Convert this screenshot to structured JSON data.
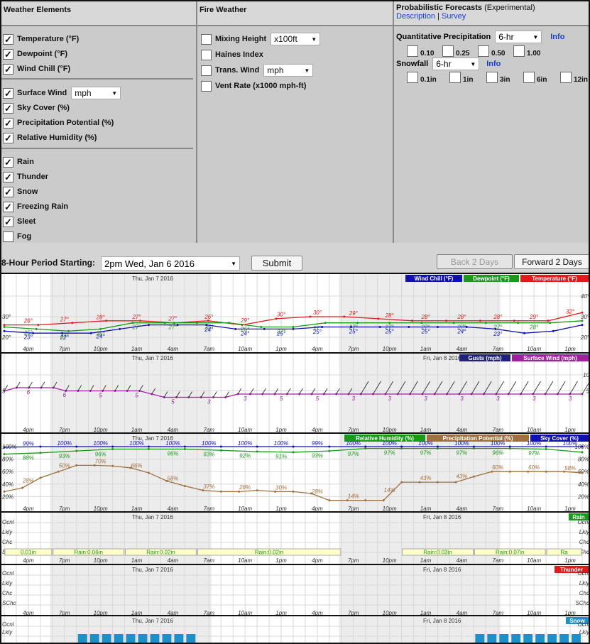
{
  "weather_elements": {
    "title": "Weather Elements",
    "group1": [
      {
        "label": "Temperature (°F)",
        "checked": true
      },
      {
        "label": "Dewpoint (°F)",
        "checked": true
      },
      {
        "label": "Wind Chill (°F)",
        "checked": true
      }
    ],
    "group2": [
      {
        "label": "Surface Wind",
        "checked": true,
        "select": "mph"
      },
      {
        "label": "Sky Cover (%)",
        "checked": true
      },
      {
        "label": "Precipitation Potential (%)",
        "checked": true
      },
      {
        "label": "Relative Humidity (%)",
        "checked": true
      }
    ],
    "group3": [
      {
        "label": "Rain",
        "checked": true
      },
      {
        "label": "Thunder",
        "checked": true
      },
      {
        "label": "Snow",
        "checked": true
      },
      {
        "label": "Freezing Rain",
        "checked": true
      },
      {
        "label": "Sleet",
        "checked": true
      },
      {
        "label": "Fog",
        "checked": false
      }
    ]
  },
  "fire_weather": {
    "title": "Fire Weather",
    "items": [
      {
        "label": "Mixing Height",
        "checked": false,
        "select": "x100ft"
      },
      {
        "label": "Haines Index",
        "checked": false
      },
      {
        "label": "Trans. Wind",
        "checked": false,
        "select": "mph"
      },
      {
        "label": "Vent Rate (x1000 mph-ft)",
        "checked": false
      }
    ]
  },
  "probabilistic": {
    "title": "Probabilistic Forecasts",
    "title_note": "(Experimental)",
    "link_description": "Description",
    "link_sep": "|",
    "link_survey": "Survey",
    "qpf_label": "Quantitative Precipitation",
    "qpf_select": "6-hr",
    "qpf_info": "Info",
    "qpf_options": [
      "0.10",
      "0.25",
      "0.50",
      "1.00"
    ],
    "snow_label": "Snowfall",
    "snow_select": "6-hr",
    "snow_info": "Info",
    "snow_options": [
      "0.1in",
      "1in",
      "3in",
      "6in",
      "12in"
    ]
  },
  "controls": {
    "period_label": "8-Hour Period Starting:",
    "period_value": "2pm Wed, Jan 6 2016",
    "submit": "Submit",
    "back": "Back 2 Days",
    "forward": "Forward 2 Days"
  },
  "time_labels": [
    "4pm",
    "7pm",
    "10pm",
    "1am",
    "4am",
    "7am",
    "10am",
    "1pm",
    "4pm",
    "7pm",
    "10pm",
    "1am",
    "4am",
    "7am",
    "10am",
    "1pm"
  ],
  "date_labels": {
    "thu": "Thu, Jan 7 2016",
    "fri": "Fri, Jan 8 2016"
  },
  "colors": {
    "temp": "#e31a1c",
    "dew": "#1a9a1a",
    "chill": "#1010b0",
    "gust": "#202080",
    "wind": "#a020a0",
    "rh": "#1a9a1a",
    "pop": "#a07040",
    "sky": "#1010b0",
    "rain": "#1a9a1a",
    "thunder": "#e31a1c",
    "snow": "#1e90c8"
  },
  "chart_data": [
    {
      "type": "line",
      "legend": [
        "Wind Chill (°F)",
        "Dewpoint (°F)",
        "Temperature (°F)"
      ],
      "y_ticks_right": [
        "40°",
        "30°",
        "20°"
      ],
      "y_ticks_left": [
        "30°",
        "20°"
      ],
      "x_hours": [
        0,
        3,
        6,
        9,
        12,
        15,
        18,
        21,
        24,
        27,
        30,
        33,
        36,
        39,
        42,
        45,
        48
      ],
      "series": [
        {
          "name": "Temperature (°F)",
          "values": [
            26,
            26,
            27,
            28,
            28,
            27,
            28,
            26,
            29,
            30,
            30,
            29,
            28,
            28,
            28,
            28,
            28,
            32
          ],
          "labels": [
            {
              "h": 2,
              "t": "26°"
            },
            {
              "h": 5,
              "t": "27°"
            },
            {
              "h": 8,
              "t": "28°"
            },
            {
              "h": 11,
              "t": "27°"
            },
            {
              "h": 14,
              "t": "27°"
            },
            {
              "h": 17,
              "t": "26°"
            },
            {
              "h": 20,
              "t": "29°"
            },
            {
              "h": 23,
              "t": "30°"
            },
            {
              "h": 26,
              "t": "30°"
            },
            {
              "h": 29,
              "t": "29°"
            },
            {
              "h": 32,
              "t": "28°"
            },
            {
              "h": 35,
              "t": "28°"
            },
            {
              "h": 38,
              "t": "28°"
            },
            {
              "h": 41,
              "t": "28°"
            },
            {
              "h": 44,
              "t": "29°"
            },
            {
              "h": 47,
              "t": "32°"
            }
          ]
        },
        {
          "name": "Dewpoint (°F)",
          "values": [
            25,
            24,
            23,
            24,
            27,
            27,
            27,
            27,
            25,
            25,
            27,
            27,
            27,
            27,
            27,
            27,
            27,
            27,
            28
          ],
          "labels": [
            {
              "h": 2,
              "t": "25°"
            },
            {
              "h": 5,
              "t": "23°"
            },
            {
              "h": 8,
              "t": "26°"
            },
            {
              "h": 11,
              "t": "27°"
            },
            {
              "h": 14,
              "t": "27°"
            },
            {
              "h": 17,
              "t": "25°"
            },
            {
              "h": 20,
              "t": "25°"
            },
            {
              "h": 23,
              "t": "27°"
            },
            {
              "h": 26,
              "t": "27°"
            },
            {
              "h": 29,
              "t": "27°"
            },
            {
              "h": 32,
              "t": "27°"
            },
            {
              "h": 35,
              "t": "27°"
            },
            {
              "h": 38,
              "t": "27°"
            },
            {
              "h": 41,
              "t": "27°"
            },
            {
              "h": 44,
              "t": "28°"
            }
          ]
        },
        {
          "name": "Wind Chill (°F)",
          "values": [
            23,
            22,
            22,
            22,
            24,
            26,
            26,
            26,
            24,
            24,
            24,
            25,
            25,
            25,
            25,
            25,
            25,
            24,
            22,
            23,
            26
          ],
          "labels": [
            {
              "h": 2,
              "t": "23°"
            },
            {
              "h": 5,
              "t": "22°"
            },
            {
              "h": 8,
              "t": "24°"
            },
            {
              "h": 17,
              "t": "24°"
            },
            {
              "h": 20,
              "t": "24°"
            },
            {
              "h": 23,
              "t": "25°"
            },
            {
              "h": 26,
              "t": "25°"
            },
            {
              "h": 29,
              "t": "25°"
            },
            {
              "h": 32,
              "t": "25°"
            },
            {
              "h": 35,
              "t": "25°"
            },
            {
              "h": 38,
              "t": "24°"
            },
            {
              "h": 41,
              "t": "23°"
            }
          ]
        }
      ]
    },
    {
      "type": "line",
      "legend": [
        "Gusts (mph)",
        "Surface Wind (mph)"
      ],
      "y_ticks_right": [
        "10",
        "5"
      ],
      "y_ticks_left": [
        "5"
      ],
      "series": [
        {
          "name": "Surface Wind (mph)",
          "values": [
            5,
            6,
            6,
            6,
            6,
            5,
            5,
            5,
            5,
            5,
            5,
            5,
            4,
            3,
            3,
            3,
            3,
            3,
            3,
            4,
            4,
            4,
            4,
            4,
            4,
            4,
            4,
            4,
            4,
            4,
            4,
            4,
            4,
            4,
            4,
            4,
            4,
            4,
            4,
            4,
            4,
            4,
            4,
            4,
            4,
            4,
            4,
            4
          ],
          "labels": [
            {
              "h": 2,
              "t": "6"
            },
            {
              "h": 5,
              "t": "6"
            },
            {
              "h": 8,
              "t": "5"
            },
            {
              "h": 11,
              "t": "5"
            },
            {
              "h": 14,
              "t": "5"
            },
            {
              "h": 17,
              "t": "3"
            },
            {
              "h": 20,
              "t": "3"
            },
            {
              "h": 23,
              "t": "5"
            },
            {
              "h": 26,
              "t": "5"
            },
            {
              "h": 29,
              "t": "3"
            },
            {
              "h": 32,
              "t": "3"
            },
            {
              "h": 35,
              "t": "3"
            },
            {
              "h": 38,
              "t": "3"
            },
            {
              "h": 41,
              "t": "3"
            },
            {
              "h": 44,
              "t": "3"
            },
            {
              "h": 47,
              "t": "3"
            }
          ]
        }
      ]
    },
    {
      "type": "line",
      "legend": [
        "Relative Humidity (%)",
        "Precipitation Potential (%)",
        "Sky Cover (%)"
      ],
      "y_ticks_right": [
        "100%",
        "80%",
        "60%",
        "40%",
        "20%"
      ],
      "y_ticks_left": [
        "100%",
        "80%",
        "60%",
        "40%",
        "20%"
      ],
      "series": [
        {
          "name": "Sky Cover (%)",
          "values": [
            99,
            100,
            100,
            100,
            100,
            100,
            100,
            100,
            100,
            100,
            100,
            100,
            100,
            100,
            100,
            100,
            100
          ],
          "labels": [
            {
              "h": 2,
              "t": "99%"
            },
            {
              "h": 5,
              "t": "100%"
            },
            {
              "h": 8,
              "t": "100%"
            },
            {
              "h": 11,
              "t": "100%"
            },
            {
              "h": 14,
              "t": "100%"
            },
            {
              "h": 17,
              "t": "100%"
            },
            {
              "h": 20,
              "t": "100%"
            },
            {
              "h": 23,
              "t": "100%"
            },
            {
              "h": 26,
              "t": "99%"
            },
            {
              "h": 29,
              "t": "100%"
            },
            {
              "h": 32,
              "t": "100%"
            },
            {
              "h": 35,
              "t": "100%"
            },
            {
              "h": 38,
              "t": "100%"
            },
            {
              "h": 41,
              "t": "100%"
            },
            {
              "h": 44,
              "t": "100%"
            },
            {
              "h": 47,
              "t": "100%"
            }
          ]
        },
        {
          "name": "Relative Humidity (%)",
          "values": [
            88,
            90,
            93,
            96,
            96,
            96,
            94,
            92,
            91,
            93,
            97,
            97,
            97,
            97,
            97,
            96,
            91
          ],
          "labels": [
            {
              "h": 2,
              "t": "88%"
            },
            {
              "h": 5,
              "t": "93%"
            },
            {
              "h": 8,
              "t": "96%"
            },
            {
              "h": 14,
              "t": "96%"
            },
            {
              "h": 17,
              "t": "93%"
            },
            {
              "h": 20,
              "t": "92%"
            },
            {
              "h": 23,
              "t": "91%"
            },
            {
              "h": 26,
              "t": "93%"
            },
            {
              "h": 29,
              "t": "97%"
            },
            {
              "h": 32,
              "t": "97%"
            },
            {
              "h": 35,
              "t": "97%"
            },
            {
              "h": 38,
              "t": "97%"
            },
            {
              "h": 41,
              "t": "96%"
            },
            {
              "h": 44,
              "t": "97%"
            }
          ]
        },
        {
          "name": "Precipitation Potential (%)",
          "values": [
            28,
            34,
            50,
            60,
            70,
            70,
            69,
            66,
            58,
            45,
            37,
            30,
            28,
            28,
            30,
            28,
            28,
            25,
            14,
            14,
            14,
            14,
            43,
            43,
            43,
            43,
            52,
            60,
            60,
            60,
            60,
            60,
            58
          ],
          "labels": [
            {
              "h": 2,
              "t": "28%"
            },
            {
              "h": 5,
              "t": "50%"
            },
            {
              "h": 8,
              "t": "70%"
            },
            {
              "h": 11,
              "t": "66%"
            },
            {
              "h": 14,
              "t": "58%"
            },
            {
              "h": 17,
              "t": "37%"
            },
            {
              "h": 20,
              "t": "28%"
            },
            {
              "h": 23,
              "t": "30%"
            },
            {
              "h": 26,
              "t": "28%"
            },
            {
              "h": 29,
              "t": "14%"
            },
            {
              "h": 32,
              "t": "14%"
            },
            {
              "h": 35,
              "t": "43%"
            },
            {
              "h": 38,
              "t": "43%"
            },
            {
              "h": 41,
              "t": "60%"
            },
            {
              "h": 44,
              "t": "60%"
            },
            {
              "h": 47,
              "t": "58%"
            }
          ]
        }
      ]
    },
    {
      "type": "table",
      "legend": [
        "Rain"
      ],
      "row_labels": [
        "Ocnl",
        "Lkly",
        "Chc",
        "SChc"
      ],
      "bars": [
        {
          "start": 0,
          "end": 4,
          "label": "0.01in"
        },
        {
          "start": 4,
          "end": 10,
          "label": "Rain:0.06in"
        },
        {
          "start": 10,
          "end": 16,
          "label": "Rain:0.02in"
        },
        {
          "start": 16,
          "end": 28,
          "label": "Rain:0.02in"
        },
        {
          "start": 33,
          "end": 39,
          "label": "Rain:0.03in"
        },
        {
          "start": 39,
          "end": 45,
          "label": "Rain:0.07in"
        },
        {
          "start": 45,
          "end": 48,
          "label": "Ra"
        }
      ]
    },
    {
      "type": "table",
      "legend": [
        "Thunder"
      ],
      "row_labels": [
        "Ocnl",
        "Lkly",
        "Chc",
        "SChc"
      ]
    },
    {
      "type": "bar",
      "legend": [
        "Snow"
      ],
      "row_labels": [
        "Ocnl",
        "Lkly"
      ],
      "bars_hours": [
        6,
        7,
        8,
        9,
        10,
        11,
        12,
        13,
        14,
        15,
        39,
        40,
        41,
        42,
        43,
        44,
        45,
        46,
        47
      ],
      "flat_hours": [
        0,
        1,
        2,
        3,
        4,
        5,
        16,
        17,
        18,
        19,
        20,
        21,
        22,
        23,
        24,
        25,
        26,
        27,
        28,
        29,
        30,
        31,
        32,
        33,
        34,
        35,
        36,
        37,
        38
      ]
    }
  ]
}
